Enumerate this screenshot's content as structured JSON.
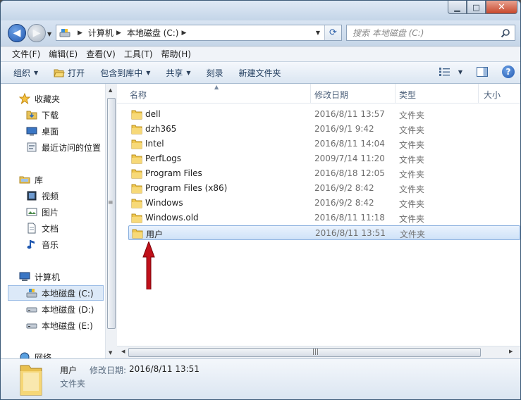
{
  "address": {
    "crumbs": [
      "计算机",
      "本地磁盘 (C:)"
    ]
  },
  "search": {
    "placeholder": "搜索 本地磁盘 (C:)"
  },
  "menu": [
    "文件(F)",
    "编辑(E)",
    "查看(V)",
    "工具(T)",
    "帮助(H)"
  ],
  "toolbar": {
    "organize": "组织",
    "open": "打开",
    "include_library": "包含到库中",
    "share": "共享",
    "burn": "刻录",
    "new_folder": "新建文件夹"
  },
  "navpane": {
    "favorites": "收藏夹",
    "downloads": "下载",
    "desktop": "桌面",
    "recent": "最近访问的位置",
    "libraries": "库",
    "videos": "视频",
    "pictures": "图片",
    "documents": "文档",
    "music": "音乐",
    "computer": "计算机",
    "drive_c": "本地磁盘 (C:)",
    "drive_d": "本地磁盘 (D:)",
    "drive_e": "本地磁盘 (E:)",
    "network": "网络"
  },
  "columns": {
    "name": "名称",
    "date": "修改日期",
    "type": "类型",
    "size": "大小"
  },
  "files": [
    {
      "name": "dell",
      "date": "2016/8/11 13:57",
      "type": "文件夹"
    },
    {
      "name": "dzh365",
      "date": "2016/9/1 9:42",
      "type": "文件夹"
    },
    {
      "name": "Intel",
      "date": "2016/8/11 14:04",
      "type": "文件夹"
    },
    {
      "name": "PerfLogs",
      "date": "2009/7/14 11:20",
      "type": "文件夹"
    },
    {
      "name": "Program Files",
      "date": "2016/8/18 12:05",
      "type": "文件夹"
    },
    {
      "name": "Program Files (x86)",
      "date": "2016/9/2 8:42",
      "type": "文件夹"
    },
    {
      "name": "Windows",
      "date": "2016/9/2 8:42",
      "type": "文件夹"
    },
    {
      "name": "Windows.old",
      "date": "2016/8/11 11:18",
      "type": "文件夹"
    },
    {
      "name": "用户",
      "date": "2016/8/11 13:51",
      "type": "文件夹"
    }
  ],
  "details": {
    "name": "用户",
    "date_label": "修改日期:",
    "date": "2016/8/11 13:51",
    "type": "文件夹"
  },
  "colors": {
    "selection": "#cfe2f8",
    "accent": "#1f57b0",
    "annotation_arrow": "#c0101a"
  }
}
